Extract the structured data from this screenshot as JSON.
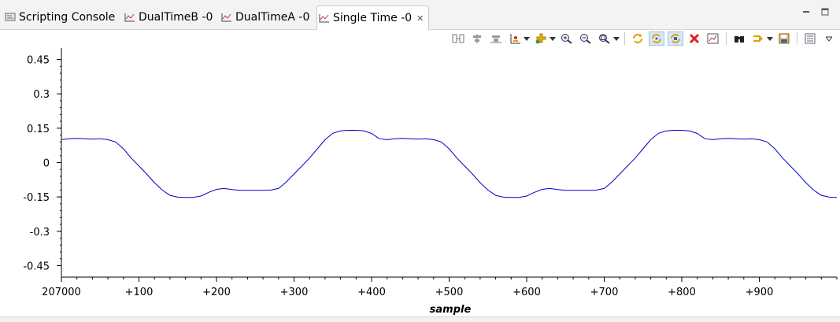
{
  "tabs": [
    {
      "label": "Scripting Console",
      "icon": "console-icon",
      "active": false
    },
    {
      "label": "DualTimeB -0",
      "icon": "graph-icon",
      "active": false
    },
    {
      "label": "DualTimeA -0",
      "icon": "graph-icon",
      "active": false
    },
    {
      "label": "Single Time -0",
      "icon": "graph-icon",
      "active": true
    }
  ],
  "toolbar_icons": [
    "split-view-icon",
    "align-center-icon",
    "align-bottom-icon",
    "axis-icon",
    "add-marker-icon",
    "zoom-in-icon",
    "zoom-out-icon",
    "zoom-fit-icon",
    "refresh-icon",
    "continuous-refresh-icon",
    "auto-refresh-icon",
    "remove-icon",
    "graph-properties-icon",
    "find-icon",
    "export-icon",
    "save-icon",
    "view-menu-icon"
  ],
  "colors": {
    "trace": "#0000cc",
    "accent": "#d8e8f8"
  },
  "chart_data": {
    "type": "line",
    "title": "",
    "xlabel": "sample",
    "ylabel": "",
    "ylim": [
      -0.5,
      0.5
    ],
    "xlim": [
      0,
      1000
    ],
    "y_ticks": [
      0.45,
      0.3,
      0.15,
      0,
      -0.15,
      -0.3,
      -0.45
    ],
    "y_tick_labels": [
      "0.45",
      "0.3",
      "0.15",
      "0",
      "-0.15",
      "-0.3",
      "-0.45"
    ],
    "x_ticks": [
      0,
      100,
      200,
      300,
      400,
      500,
      600,
      700,
      800,
      900
    ],
    "x_tick_labels": [
      "207000",
      "+100",
      "+200",
      "+300",
      "+400",
      "+500",
      "+600",
      "+700",
      "+800",
      "+900"
    ],
    "series": [
      {
        "color": "#0000cc",
        "x": [
          0,
          10,
          20,
          30,
          40,
          50,
          60,
          70,
          80,
          90,
          100,
          110,
          120,
          130,
          140,
          150,
          160,
          170,
          180,
          190,
          200,
          210,
          220,
          230,
          240,
          250,
          260,
          270,
          280,
          290,
          300,
          310,
          320,
          330,
          340,
          350,
          360,
          370,
          380,
          390,
          400,
          410,
          420,
          430,
          440,
          450,
          460,
          470,
          480,
          490,
          500,
          510,
          520,
          530,
          540,
          550,
          560,
          570,
          580,
          590,
          600,
          610,
          620,
          630,
          640,
          650,
          660,
          670,
          680,
          690,
          700,
          710,
          720,
          730,
          740,
          750,
          760,
          770,
          780,
          790,
          800,
          810,
          820,
          830,
          840,
          850,
          860,
          870,
          880,
          890,
          900,
          910,
          920,
          930,
          940,
          950,
          960,
          970,
          980,
          990,
          1000
        ],
        "y": [
          0.1,
          0.104,
          0.106,
          0.104,
          0.102,
          0.104,
          0.1,
          0.09,
          0.06,
          0.02,
          -0.015,
          -0.05,
          -0.088,
          -0.12,
          -0.143,
          -0.151,
          -0.152,
          -0.152,
          -0.146,
          -0.13,
          -0.117,
          -0.113,
          -0.118,
          -0.121,
          -0.121,
          -0.121,
          -0.121,
          -0.12,
          -0.113,
          -0.085,
          -0.05,
          -0.015,
          0.02,
          0.06,
          0.1,
          0.128,
          0.138,
          0.141,
          0.141,
          0.138,
          0.127,
          0.104,
          0.1,
          0.104,
          0.106,
          0.104,
          0.102,
          0.104,
          0.1,
          0.09,
          0.06,
          0.02,
          -0.015,
          -0.05,
          -0.088,
          -0.12,
          -0.143,
          -0.151,
          -0.152,
          -0.152,
          -0.146,
          -0.13,
          -0.117,
          -0.113,
          -0.118,
          -0.121,
          -0.121,
          -0.121,
          -0.121,
          -0.12,
          -0.113,
          -0.085,
          -0.05,
          -0.015,
          0.02,
          0.06,
          0.1,
          0.128,
          0.138,
          0.141,
          0.141,
          0.138,
          0.127,
          0.104,
          0.1,
          0.104,
          0.106,
          0.104,
          0.102,
          0.104,
          0.1,
          0.09,
          0.06,
          0.02,
          -0.015,
          -0.05,
          -0.088,
          -0.12,
          -0.143,
          -0.151,
          -0.152
        ]
      }
    ]
  }
}
